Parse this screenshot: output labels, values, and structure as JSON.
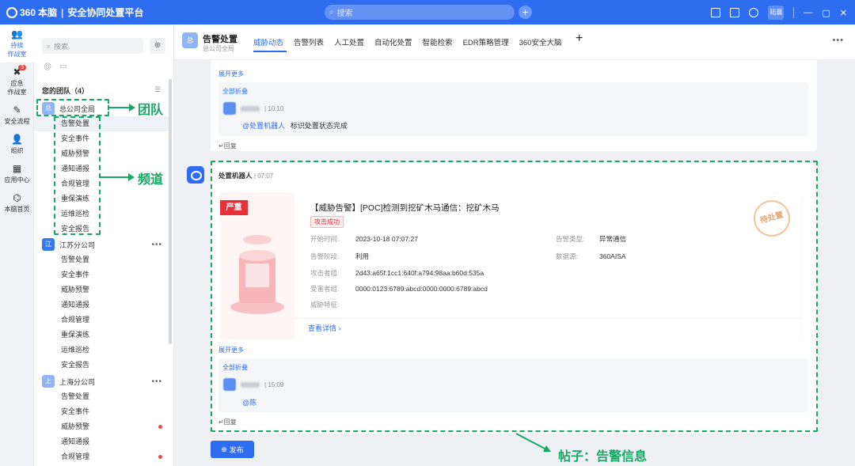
{
  "titlebar": {
    "brand_logo_text": "360",
    "brand_name": "本脑",
    "brand_product": "安全协同处置平台",
    "search_placeholder": "搜索",
    "avatar_label": "陆晨"
  },
  "rail": {
    "items": [
      {
        "label_line1": "持续",
        "label_line2": "作战室",
        "icon": "team-icon",
        "active": true
      },
      {
        "label_line1": "应急",
        "label_line2": "作战室",
        "icon": "emergency-icon",
        "badge": "3"
      },
      {
        "label_line1": "安全流程",
        "label_line2": "",
        "icon": "flow-icon"
      },
      {
        "label_line1": "组织",
        "label_line2": "",
        "icon": "org-icon"
      },
      {
        "label_line1": "应用中心",
        "label_line2": "",
        "icon": "apps-icon"
      },
      {
        "label_line1": "本脑首页",
        "label_line2": "",
        "icon": "home-icon"
      }
    ]
  },
  "channels": {
    "search_placeholder": "搜索",
    "team_title": "您的团队（4）",
    "groups": [
      {
        "avatar": "总",
        "name": "总公司全局",
        "subs": [
          "告警处置",
          "安全事件",
          "威胁预警",
          "通知通报",
          "合规管理",
          "重保演练",
          "运维巡检",
          "安全报告"
        ]
      },
      {
        "avatar": "江",
        "name": "江苏分公司",
        "subs": [
          "告警处置",
          "安全事件",
          "威胁预警",
          "通知通报",
          "合规管理",
          "重保演练",
          "运维巡检",
          "安全报告"
        ]
      },
      {
        "avatar": "上",
        "name": "上海分公司",
        "subs": [
          "告警处置",
          "安全事件",
          "威胁预警",
          "通知通报",
          "合规管理"
        ]
      }
    ]
  },
  "mainhead": {
    "avatar": "总",
    "title": "告警处置",
    "subtitle": "总公司全局",
    "tabs": [
      "威胁动态",
      "告警列表",
      "人工处置",
      "自动化处置",
      "智能检索",
      "EDR策略管理",
      "360安全大脑"
    ]
  },
  "post1": {
    "expand_more": "展开更多",
    "collapse_all": "全部折叠",
    "reply_time": "10:10",
    "mention": "@处置机器人",
    "reply_text": "标识处置状态完成",
    "reply_label": "回复"
  },
  "post2": {
    "author": "处置机器人",
    "time": "07:07",
    "severity": "严重",
    "alert_title": "【威胁告警】[POC]检测到挖矿木马通信：挖矿木马",
    "tag": "攻击成功",
    "fields": {
      "start_time_label": "开始时间:",
      "start_time": "2023-10-18 07:07:27",
      "alert_type_label": "告警类型:",
      "alert_type": "异常通信",
      "stage_label": "告警阶段:",
      "stage": "利用",
      "source_label": "数据源:",
      "source": "360AISA",
      "attacker_label": "攻击者组:",
      "attacker": "2d43:a65f:1cc1:640f:a794:98aa:b60d:535a",
      "victim_label": "受害者组:",
      "victim": "0000:0123:6789:abcd:0000:0000:6789:abcd",
      "feature_label": "威胁特征:"
    },
    "stamp": "待处置",
    "detail_link": "查看详情",
    "expand_more": "展开更多",
    "collapse_all": "全部折叠",
    "reply_time": "15:09",
    "mention": "@陈",
    "reply_label": "回复"
  },
  "publish_label": "发布",
  "annotations": {
    "team": "团队",
    "channel": "频道",
    "post": "帖子：告警信息"
  },
  "colors": {
    "primary": "#2f6df0",
    "severity": "#e8303a",
    "annotation": "#17a866"
  }
}
